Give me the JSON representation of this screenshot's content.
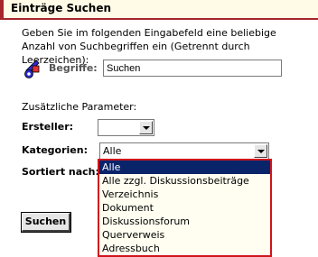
{
  "header": {
    "title": "Einträge Suchen",
    "accent_color": "#a7252c"
  },
  "description": "Geben Sie im folgenden Eingabefeld eine beliebige Anzahl von Suchbegriffen ein (Getrennt durch Leerzeichen):",
  "keywords": {
    "icon": "key-search-icon",
    "label": "Begriffe:",
    "value": "Suchen"
  },
  "extra_params_label": "Zusätzliche Parameter:",
  "creator": {
    "label": "Ersteller:",
    "value": ""
  },
  "categories": {
    "label": "Kategorien:",
    "value": "Alle",
    "options": [
      "Alle",
      "Alle zzgl. Diskussionsbeiträge",
      "Verzeichnis",
      "Dokument",
      "Diskussionsforum",
      "Querverweis",
      "Adressbuch"
    ],
    "selected_index": 0,
    "highlight_color": "#0a246a",
    "list_border_color": "#d0141c"
  },
  "sort_label": "Sortiert nach:",
  "search_button": "Suchen"
}
